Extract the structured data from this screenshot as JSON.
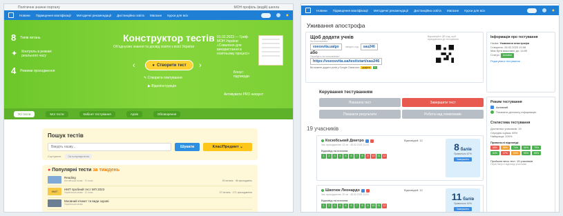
{
  "left": {
    "topbar": {
      "left": "Політичне значне порталу",
      "right": "МОН профіль (водій) шелла"
    },
    "nav": [
      "Новини",
      "Підвищення кваліфікації",
      "Методичні рекомендації",
      "Дистанційна освіта",
      "Магазин",
      "Курси для всіх"
    ],
    "hero": {
      "title": "Конструктор тестів",
      "subtitle": "Об'єднуємо знання та досвід освіти з всієї України",
      "stats": [
        {
          "big": "8",
          "label": "Типів питань"
        },
        {
          "big": "≈",
          "label": "Контроль в режимі реального часу"
        },
        {
          "big": "4",
          "label": "Режими проходження"
        }
      ],
      "cta": "Створити тест",
      "secondary": [
        "Створити опитування",
        "Відеоінструкція"
      ],
      "grant": "01.02.2023 — Гриф МОН України «Схвалено для використання в освітньому процесі»",
      "award": "Бонус: підтверди",
      "pro": "Активувати PRO аккаунт"
    },
    "tabs": [
      "Усі тести",
      "Мої тести",
      "Кабінет тестування",
      "Архів",
      "Обговорення"
    ],
    "search": {
      "title": "Пошук тестів",
      "placeholder": "Введіть назву...",
      "button": "Шукати",
      "category": "Клас/Предмет",
      "sort_label": "Сортувати",
      "sort_tag": "За популярністю"
    },
    "popular": {
      "title": "Популярні тести",
      "highlight": "за тиждень",
      "items": [
        {
          "thumb": "",
          "title": "Reading",
          "meta": "Англійська мова · 10 клас",
          "stats": "30 питань · 46 проходжень"
        },
        {
          "thumb": "НМТ",
          "title": "НМТ пробний тест МП 2023",
          "meta": "Українська мова · 11 клас",
          "stats": "27 питань · 171 проходження"
        },
        {
          "thumb": "",
          "title": "Моовний етикет та види зорові",
          "meta": "Українська мова",
          "stats": ""
        }
      ]
    }
  },
  "right": {
    "nav": [
      "Новини",
      "Підвищення кваліфікації",
      "Методичні рекомендації",
      "Дистанційна освіта",
      "Магазин",
      "Курси для всіх"
    ],
    "page_title": "Уживання апострофа",
    "share": {
      "title": "Щоб додати учнів",
      "s1": "За посиланням:",
      "link": "vseosvita.ua/go",
      "enter_code": "введіть код",
      "code": "sau246",
      "or": "або",
      "s2": "Перейдіть за посиланням:",
      "url": "https://vseosvita.ua/test/start/sau246",
      "google": "Ви можете додати учнів у Google Classroom",
      "g_btn1": "додати",
      "g_btn2": "+",
      "qr_caption": "Відскануйте QR-код, щоб приєднатися до тестування"
    },
    "info": {
      "title": "Інформація про тестування",
      "name_label": "Назва:",
      "name_value": "Уживання апострофа",
      "created": "Створено: 28.02.2023 10:08",
      "until": "Має бути виконано до: 14:00",
      "status_label": "Статус:",
      "status_value": "Активне",
      "edit_link": "Редагувати тестування"
    },
    "controls": {
      "title": "Керування тестуванням",
      "show_test": "Показати тест",
      "finish": "Завершити тест",
      "show_results": "Показати результати",
      "work": "Робота над помилками"
    },
    "participants_title": "19 учасників",
    "participants": [
      {
        "name": "Косюбський Дмитро",
        "meta": "Час проходження: 12 хв · 28.02.2023 11:20",
        "answers_label": "Відповіді на питання:",
        "answers": [
          "1",
          "2",
          "3",
          "4",
          "5",
          "6",
          "7",
          "8",
          "9",
          "10",
          "11",
          "12"
        ],
        "status": [
          "g",
          "g",
          "g",
          "g",
          "g",
          "g",
          "g",
          "g",
          "r",
          "r",
          "g",
          "r"
        ],
        "mid": "Відповідей: 12",
        "score": "8",
        "unit": "балів",
        "pct": "Правильно 67%",
        "state": "Завершено"
      },
      {
        "name": "Шкотюк Леонардо",
        "meta": "Час проходження: 20 хв · 28.02.2023 11:21",
        "answers_label": "Відповіді на питання:",
        "answers": [
          "1",
          "2",
          "3",
          "4",
          "5",
          "6",
          "7",
          "8",
          "9",
          "10",
          "11",
          "12"
        ],
        "status": [
          "g",
          "g",
          "g",
          "g",
          "g",
          "g",
          "g",
          "g",
          "g",
          "g",
          "g",
          "r"
        ],
        "mid": "Відповідей: 12",
        "score": "11",
        "unit": "балів",
        "pct": "Правильно 92%",
        "state": "Завершено"
      }
    ],
    "mode": {
      "title": "Режим тестування",
      "active": "Активний",
      "show_details": "Показати детальну інформацію"
    },
    "stats": {
      "title": "Статистика тестування",
      "taken": "Достатньо учасників: 19",
      "avg": "Середня оцінка: 83%",
      "best": "Найкраща: 100%",
      "right_title": "Правильні відповіді:",
      "chips": [
        "68%",
        "58%",
        "74%",
        "90%",
        "79%",
        "84%",
        "47%",
        "63%",
        "95%",
        "89%"
      ],
      "colors": [
        "#e85a4f",
        "#f0a030",
        "#4caf50",
        "#4caf50",
        "#4caf50",
        "#4caf50",
        "#e85a4f",
        "#f0a030",
        "#4caf50",
        "#4caf50"
      ],
      "foot": "Пройшли весь тест: 19 учасників",
      "foot2": "Переглянути відповіді учасників"
    }
  }
}
